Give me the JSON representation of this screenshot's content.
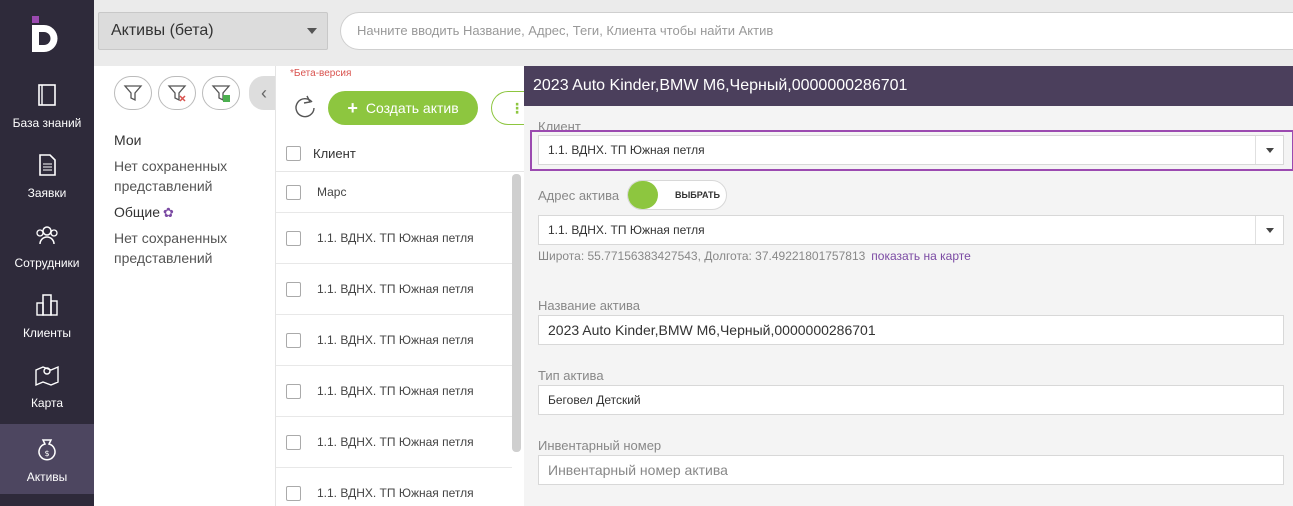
{
  "nav": {
    "items": [
      {
        "label": "База знаний",
        "icon": "book-icon"
      },
      {
        "label": "Заявки",
        "icon": "document-icon"
      },
      {
        "label": "Сотрудники",
        "icon": "users-icon"
      },
      {
        "label": "Клиенты",
        "icon": "buildings-icon"
      },
      {
        "label": "Карта",
        "icon": "map-icon"
      },
      {
        "label": "Активы",
        "icon": "money-bag-icon"
      }
    ]
  },
  "topbar": {
    "module": "Активы (бета)",
    "search_placeholder": "Начните вводить Название, Адрес, Теги, Клиента чтобы найти Актив"
  },
  "filters": {
    "mine_title": "Мои",
    "mine_text": "Нет сохраненных представлений",
    "shared_title": "Общие",
    "shared_text": "Нет сохраненных представлений"
  },
  "list": {
    "beta_note": "*Бета-версия",
    "create_label": "Создать актив",
    "more_label": "⋮",
    "column_header": "Клиент",
    "rows": [
      "Марс",
      "1.1. ВДНХ. ТП Южная петля",
      "1.1. ВДНХ. ТП Южная петля",
      "1.1. ВДНХ. ТП Южная петля",
      "1.1. ВДНХ. ТП Южная петля",
      "1.1. ВДНХ. ТП Южная петля",
      "1.1. ВДНХ. ТП Южная петля"
    ]
  },
  "detail": {
    "title": "2023 Auto Kinder,BMW M6,Черный,0000000286701",
    "client_label": "Клиент",
    "client_value": "1.1. ВДНХ. ТП Южная петля",
    "address_label": "Адрес актива",
    "toggle_label": "ВЫБРАТЬ",
    "address_value": "1.1. ВДНХ. ТП Южная петля",
    "coords": "Широта: 55.77156383427543, Долгота: 37.49221801757813",
    "map_link": "показать на карте",
    "name_label": "Название актива",
    "name_value": "2023 Auto Kinder,BMW M6,Черный,0000000286701",
    "type_label": "Тип актива",
    "type_value": "Беговел Детский",
    "inv_label": "Инвентарный номер",
    "inv_placeholder": "Инвентарный номер актива"
  },
  "colors": {
    "sidebar": "#2e2a3a",
    "accent_green": "#8dc63f",
    "header_purple": "#4b3f5c",
    "highlight": "#9b4ab0"
  }
}
